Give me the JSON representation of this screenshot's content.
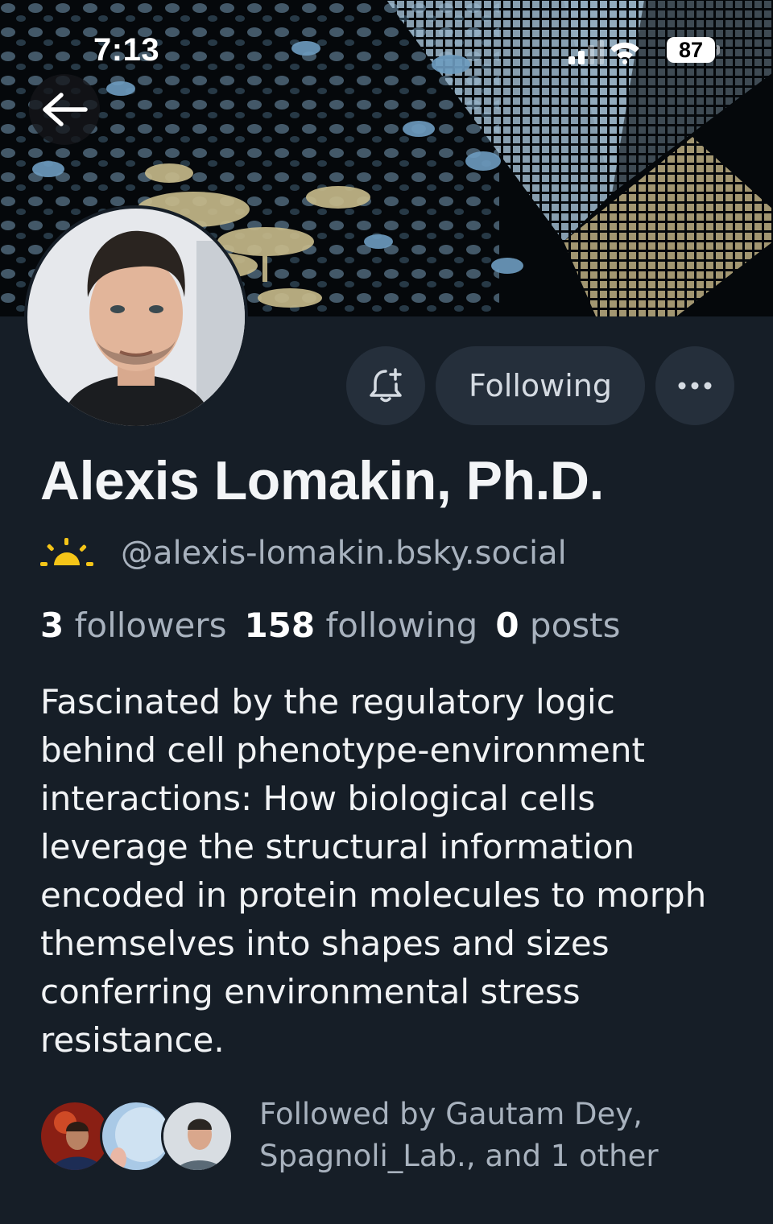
{
  "status_bar": {
    "time": "7:13",
    "battery": "87"
  },
  "profile": {
    "display_name": "Alexis Lomakin, Ph.D.",
    "handle": "@alexis-lomakin.bsky.social",
    "stats": {
      "followers_count": "3",
      "followers_label": "followers",
      "following_count": "158",
      "following_label": "following",
      "posts_count": "0",
      "posts_label": "posts"
    },
    "bio_lines": [
      "Fascinated by the regulatory logic",
      "behind cell phenotype-environment",
      "interactions: How biological cells",
      "leverage the structural information",
      "encoded in protein molecules to morph",
      "themselves into shapes and sizes",
      "conferring environmental stress",
      "resistance."
    ]
  },
  "actions": {
    "follow_label": "Following"
  },
  "followed_by": {
    "line1": "Followed by Gautam Dey,",
    "line2": "Spagnoli_Lab., and 1 other"
  },
  "icons": {
    "back": "arrow-left-icon",
    "bell": "bell-plus-icon",
    "more": "more-horizontal-icon",
    "handle_badge": "sunrise-icon"
  },
  "colors": {
    "background": "#161e27",
    "button_bg": "#252f3b",
    "muted_text": "#a8b2be",
    "accent_sun": "#f5c518"
  }
}
